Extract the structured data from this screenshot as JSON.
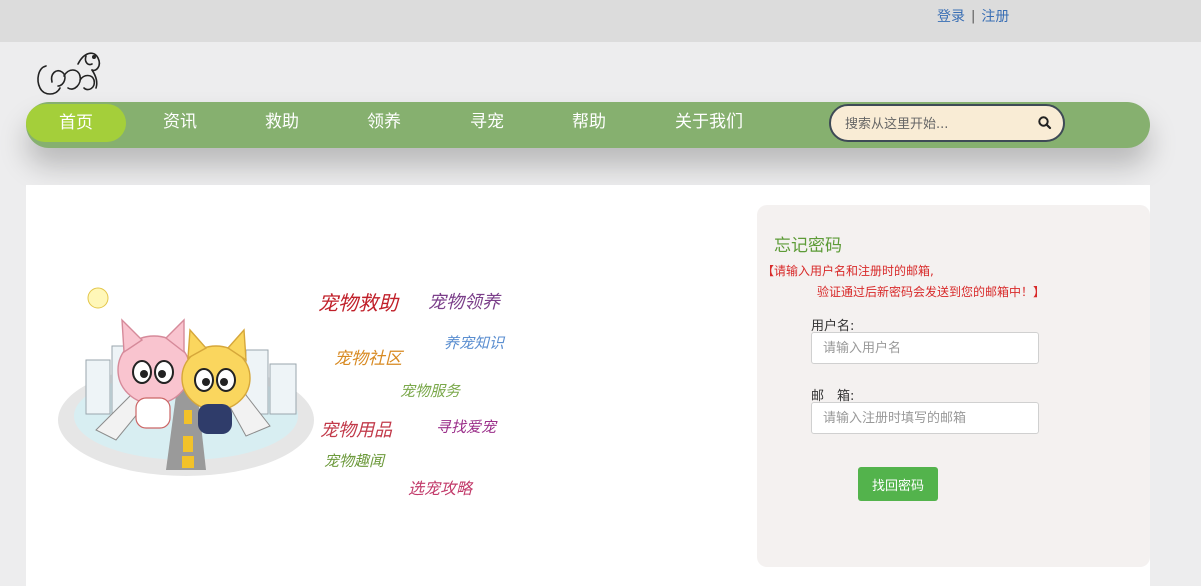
{
  "auth": {
    "login": "登录",
    "separator": "|",
    "register": "注册"
  },
  "nav": {
    "items": [
      {
        "label": "首页",
        "active": true
      },
      {
        "label": "资讯"
      },
      {
        "label": "救助"
      },
      {
        "label": "领养"
      },
      {
        "label": "寻宠"
      },
      {
        "label": "帮助"
      },
      {
        "label": "关于我们"
      }
    ],
    "search_placeholder": "搜索从这里开始..."
  },
  "illustration": {
    "words": [
      "宠物救助",
      "宠物领养",
      "宠物社区",
      "养宠知识",
      "宠物服务",
      "宠物用品",
      "寻找爱宠",
      "宠物趣闻",
      "选宠攻略"
    ]
  },
  "form": {
    "title": "忘记密码",
    "hint_line1": "【请输入用户名和注册时的邮箱,",
    "hint_line2": "验证通过后新密码会发送到您的邮箱中！】",
    "username_label": "用户名:",
    "username_placeholder": "请输入用户名",
    "email_label": "邮　箱:",
    "email_placeholder": "请输入注册时填写的邮箱",
    "submit": "找回密码"
  },
  "colors": {
    "nav_bg": "#86b06f",
    "nav_active": "#a4cf3a",
    "title_green": "#5d9b37",
    "hint_red": "#d82a2a",
    "button_green": "#53b34c"
  }
}
